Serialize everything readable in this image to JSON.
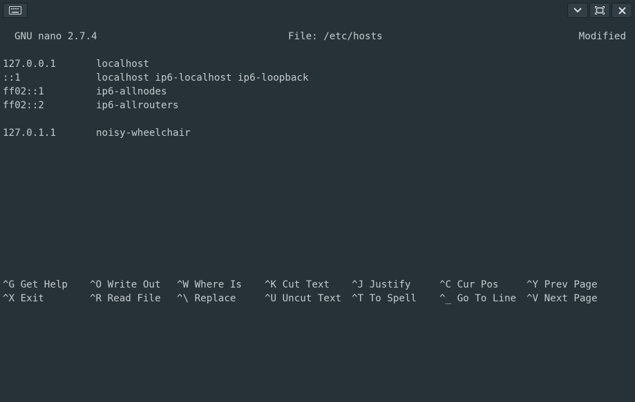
{
  "window": {
    "keyboard_icon": "keyboard-icon",
    "minimize_icon": "chevron-down-icon",
    "maximize_icon": "maximize-icon",
    "close_icon": "close-icon"
  },
  "status": {
    "app": "GNU nano 2.7.4",
    "file": "File: /etc/hosts",
    "state": "Modified"
  },
  "hosts": [
    {
      "ip": "127.0.0.1",
      "names": "localhost"
    },
    {
      "ip": "::1",
      "names": "localhost ip6-localhost ip6-loopback"
    },
    {
      "ip": "ff02::1",
      "names": "ip6-allnodes"
    },
    {
      "ip": "ff02::2",
      "names": "ip6-allrouters"
    },
    {
      "ip": "",
      "names": ""
    },
    {
      "ip": "127.0.1.1",
      "names": "noisy-wheelchair"
    }
  ],
  "shortcuts": {
    "row1": [
      {
        "key": "^G",
        "label": "Get Help"
      },
      {
        "key": "^O",
        "label": "Write Out"
      },
      {
        "key": "^W",
        "label": "Where Is"
      },
      {
        "key": "^K",
        "label": "Cut Text"
      },
      {
        "key": "^J",
        "label": "Justify"
      },
      {
        "key": "^C",
        "label": "Cur Pos"
      },
      {
        "key": "^Y",
        "label": "Prev Page"
      }
    ],
    "row2": [
      {
        "key": "^X",
        "label": "Exit"
      },
      {
        "key": "^R",
        "label": "Read File"
      },
      {
        "key": "^\\",
        "label": "Replace"
      },
      {
        "key": "^U",
        "label": "Uncut Text"
      },
      {
        "key": "^T",
        "label": "To Spell"
      },
      {
        "key": "^_",
        "label": "Go To Line"
      },
      {
        "key": "^V",
        "label": "Next Page"
      }
    ]
  }
}
